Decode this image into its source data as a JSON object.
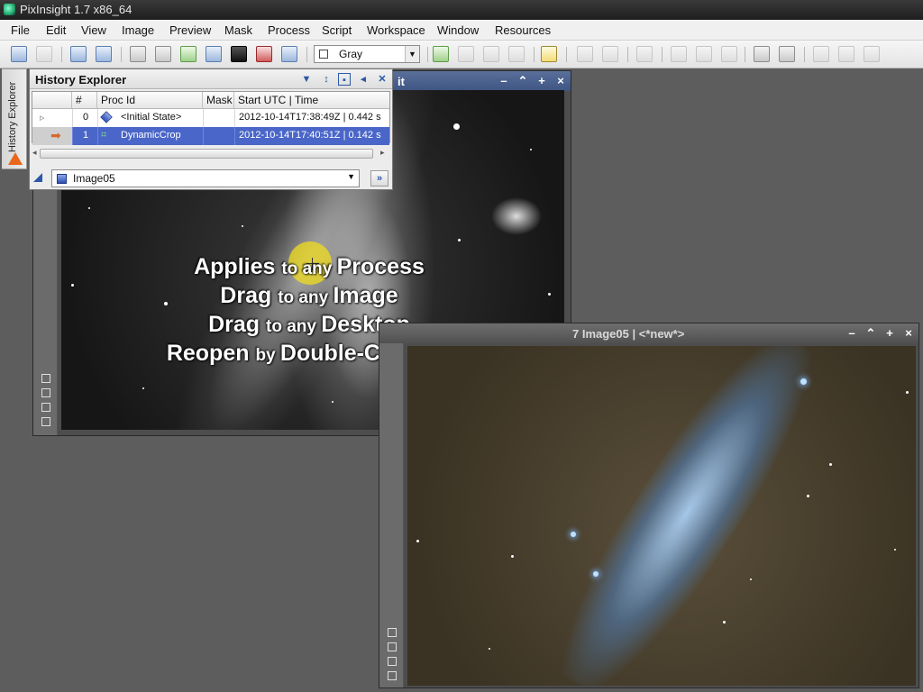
{
  "app": {
    "title": "PixInsight 1.7 x86_64"
  },
  "menu": [
    "File",
    "Edit",
    "View",
    "Image",
    "Preview",
    "Mask",
    "Process",
    "Script",
    "Workspace",
    "Window",
    "Resources"
  ],
  "toolbar": {
    "channel_value": "Gray"
  },
  "side_tab": {
    "label": "History Explorer"
  },
  "history_explorer": {
    "title": "History Explorer",
    "columns": [
      "#",
      "Proc Id",
      "Mask",
      "Start UTC | Time"
    ],
    "rows": [
      {
        "index": "0",
        "proc_id": "<Initial State>",
        "mask": "",
        "start": "2012-10-14T17:38:49Z | 0.442 s",
        "selected": false
      },
      {
        "index": "1",
        "proc_id": "DynamicCrop",
        "mask": "",
        "start": "2012-10-14T17:40:51Z | 0.142 s",
        "selected": true
      }
    ],
    "view_selector": "Image05"
  },
  "window1": {
    "title_fragment": "it"
  },
  "window2": {
    "title": "7 Image05 | <*new*>"
  },
  "overlay": {
    "line1": {
      "a": "Applies ",
      "b": "to ",
      "c": "any ",
      "d": "Process"
    },
    "line2": {
      "a": "Drag ",
      "b": "to any ",
      "c": "Image"
    },
    "line3": {
      "a": "Drag ",
      "b": "to any ",
      "c": "Desktop"
    },
    "line4": {
      "a": "Reopen ",
      "b": "by ",
      "c": "Double-Clicking"
    }
  },
  "colors": {
    "active_title": "#3e5483",
    "selection": "#4a66c8",
    "warning": "#e8671b"
  }
}
